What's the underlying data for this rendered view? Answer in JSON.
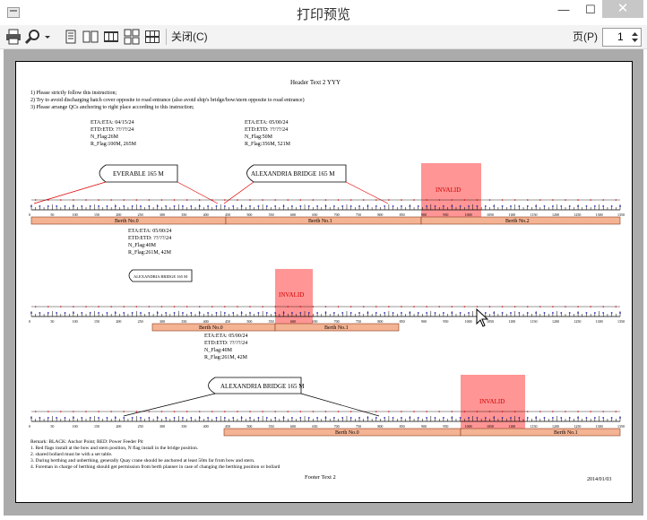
{
  "window": {
    "title": "打印预览",
    "minimize_label": "—",
    "maximize_label": "☐",
    "close_label": "✕"
  },
  "toolbar": {
    "close_label": "关闭(C)",
    "page_label": "页(P)",
    "page_value": "1"
  },
  "document": {
    "header": "Header Text 2      YYY",
    "footer": "Footer Text 2",
    "date": "2014/01/03",
    "instructions": [
      "1) Please strictly follow this instruction;",
      "2) Try to avoid discharging hatch cover opposite to road entrance (also avoid ship's bridge/bow/stern opposite to road entrance)",
      "3) Please arrange QCs anchoring to right place according to this instruction;"
    ],
    "remarks": [
      "Remark: BLACK: Anchor Point; RED: Power Feeder Pit",
      "1. Red flags install at the bow and stern position, N flag install in the bridge position.",
      "2. shared bollard must be with a set table.",
      "3. During berthing and unberthing, generally Quay crane should be anchored at least 50m far from bow and stern.",
      "4. Foreman in charge of berthing should get permission from berth planner in case of changing the berthing position or bollard"
    ],
    "invalid_label": "INVALID",
    "ships": [
      {
        "name": "EVERABLE 165 M",
        "info": [
          "ETA:ETA: 04/15/24",
          "ETD:ETD: ??/??/24",
          "N_Flag:26M",
          "R_Flag:100M, 265M"
        ]
      },
      {
        "name": "ALEXANDRIA BRIDGE 165 M",
        "info": [
          "ETA:ETA: 05/00/24",
          "ETD:ETD: ??/??/24",
          "N_Flag:50M",
          "R_Flag:356M, 521M"
        ]
      },
      {
        "name": "ALEXANDRIA BRIDGE 165 M",
        "info": [
          "ETA:ETA: 05/00/24",
          "ETD:ETD: ??/??/24",
          "N_Flag:40M",
          "R_Flag:261M, 42M"
        ]
      },
      {
        "name": "ALEXANDRIA BRIDGE 165 M",
        "info": [
          "ETA:ETA: 05/00/24",
          "ETD:ETD: ??/??/24",
          "N_Flag:40M",
          "R_Flag:261M, 42M"
        ]
      }
    ],
    "berths": [
      "Berth No.0",
      "Berth No.1",
      "Berth No.2"
    ],
    "scale_labels": [
      "0",
      "50",
      "100",
      "150",
      "200",
      "250",
      "300",
      "350",
      "400",
      "450",
      "500",
      "550",
      "600",
      "650",
      "700",
      "750",
      "800",
      "850",
      "900",
      "950",
      "1000",
      "1050",
      "1100",
      "1150",
      "1200",
      "1250",
      "1300",
      "1350"
    ]
  }
}
